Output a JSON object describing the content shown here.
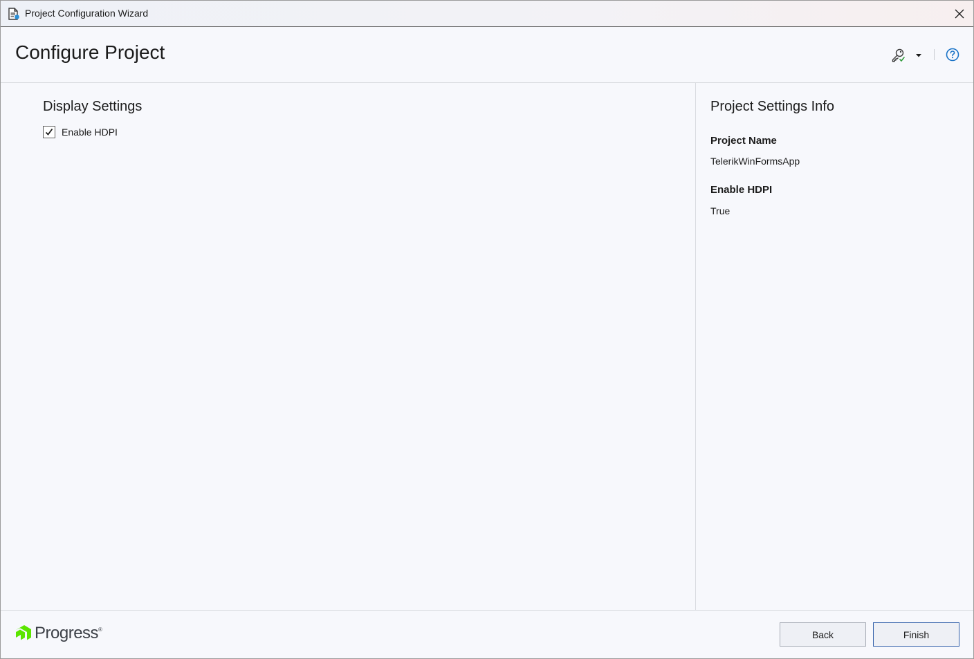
{
  "window": {
    "title": "Project Configuration Wizard"
  },
  "header": {
    "title": "Configure Project"
  },
  "display_settings": {
    "title": "Display Settings",
    "enable_hdpi_label": "Enable HDPI",
    "enable_hdpi_checked": true
  },
  "info": {
    "title": "Project Settings Info",
    "items": [
      {
        "label": "Project Name",
        "value": "TelerikWinFormsApp"
      },
      {
        "label": "Enable HDPI",
        "value": "True"
      }
    ]
  },
  "footer": {
    "logo_text": "Progress",
    "back_label": "Back",
    "finish_label": "Finish"
  },
  "icons": {
    "app": "wizard-document-icon",
    "close": "close-icon",
    "settings": "key-settings-icon",
    "dropdown": "caret-down-icon",
    "help": "help-circle-icon"
  },
  "colors": {
    "logo_green": "#5ce500",
    "help_blue": "#1a73c7",
    "primary_border": "#2f5ea8"
  }
}
